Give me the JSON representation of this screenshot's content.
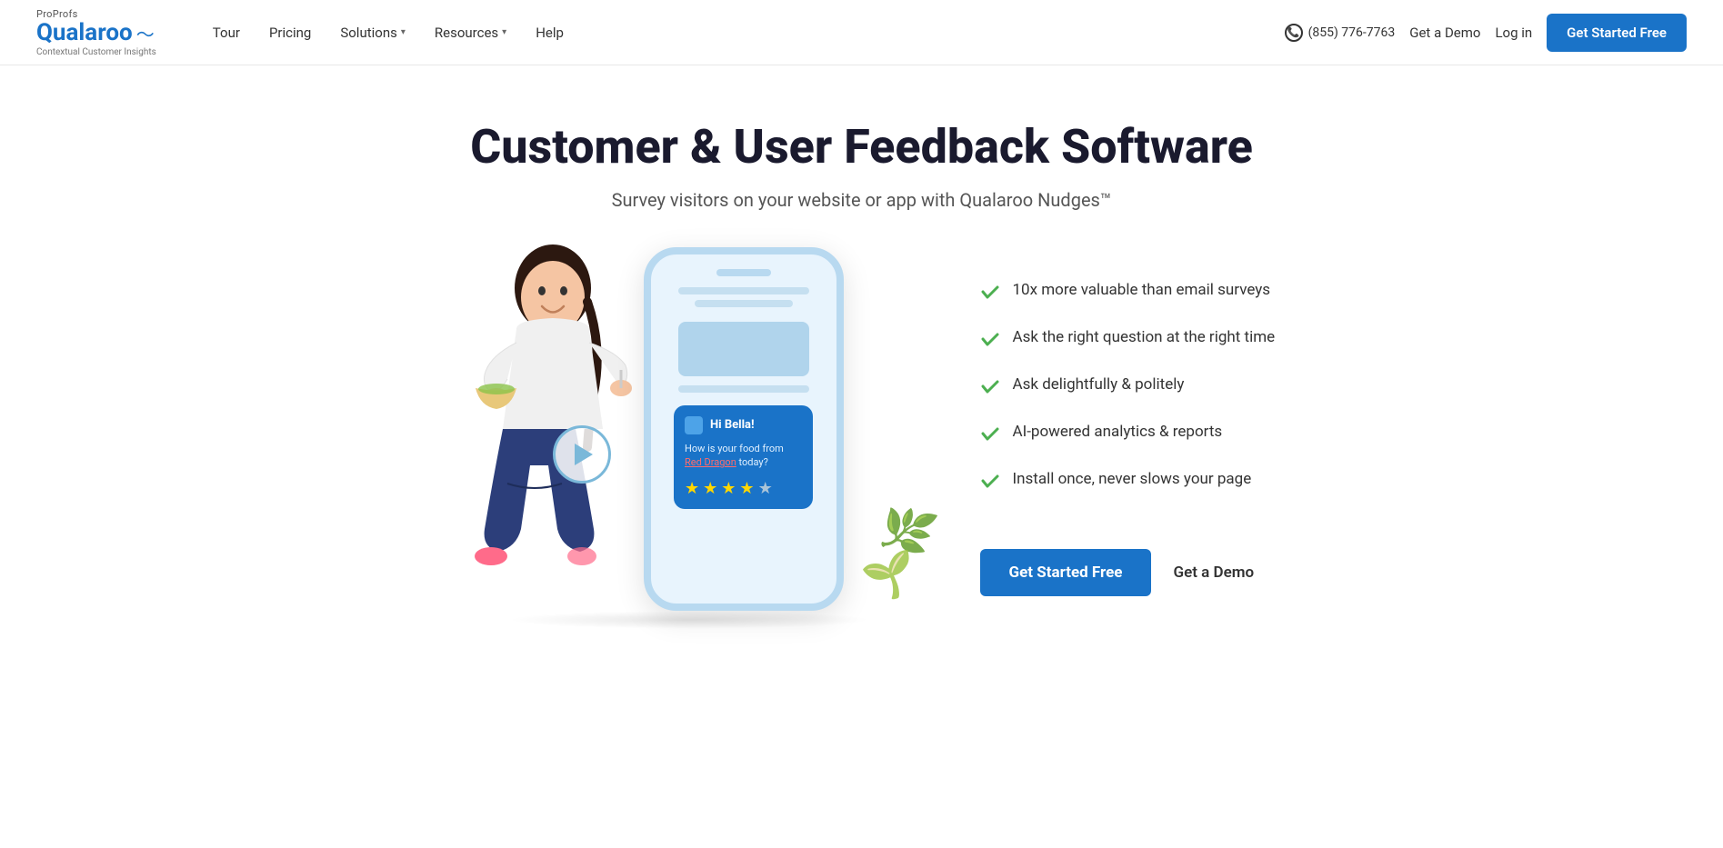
{
  "brand": {
    "proprofs": "ProProfs",
    "name": "Qualaroo",
    "tagline": "Contextual Customer Insights"
  },
  "nav": {
    "tour_label": "Tour",
    "pricing_label": "Pricing",
    "solutions_label": "Solutions",
    "resources_label": "Resources",
    "help_label": "Help",
    "phone": "(855) 776-7763",
    "demo_label": "Get a Demo",
    "login_label": "Log in",
    "cta_label": "Get Started Free"
  },
  "hero": {
    "title": "Customer & User Feedback Software",
    "subtitle": "Survey visitors on your website or app with Qualaroo Nudges™",
    "features": [
      {
        "text": "10x more valuable than email surveys"
      },
      {
        "text": "Ask the right question at the right time"
      },
      {
        "text": "Ask delightfully & politely"
      },
      {
        "text": "AI-powered analytics & reports"
      },
      {
        "text": "Install once, never slows your page"
      }
    ],
    "cta_primary": "Get Started Free",
    "cta_secondary": "Get a Demo"
  },
  "nudge": {
    "greeting": "Hi Bella!",
    "question_part1": "How is your food",
    "question_part2": "from",
    "question_link": "Red Dragon",
    "question_part3": "today?",
    "stars": [
      true,
      true,
      true,
      true,
      false
    ]
  }
}
